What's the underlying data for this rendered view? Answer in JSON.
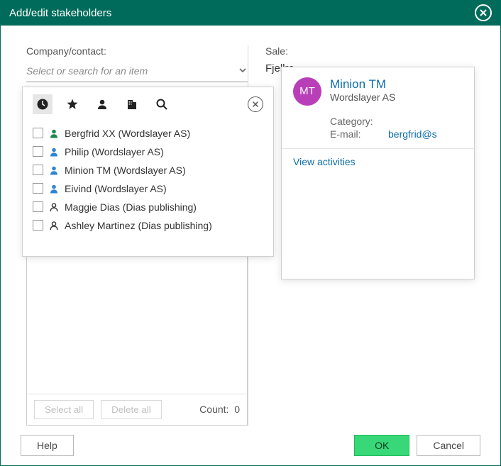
{
  "title": "Add/edit stakeholders",
  "left": {
    "label": "Company/contact:",
    "placeholder": "Select or search for an item"
  },
  "right": {
    "label": "Sale:",
    "value": "Fjellro"
  },
  "dropdown": {
    "items": [
      {
        "name": "Bergfrid XX",
        "company": "(Wordslayer AS)",
        "iconColor": "#1c8b4a",
        "iconType": "solid"
      },
      {
        "name": "Philip",
        "company": "(Wordslayer AS)",
        "iconColor": "#2f86d4",
        "iconType": "solid"
      },
      {
        "name": "Minion TM",
        "company": "(Wordslayer AS)",
        "iconColor": "#2f86d4",
        "iconType": "solid"
      },
      {
        "name": "Eivind",
        "company": "(Wordslayer AS)",
        "iconColor": "#2f86d4",
        "iconType": "solid"
      },
      {
        "name": "Maggie Dias",
        "company": "(Dias publishing)",
        "iconColor": "#333333",
        "iconType": "outline"
      },
      {
        "name": "Ashley Martinez",
        "company": "(Dias publishing)",
        "iconColor": "#333333",
        "iconType": "outline"
      }
    ]
  },
  "card": {
    "initials": "MT",
    "name": "Minion TM",
    "company": "Wordslayer AS",
    "categoryLabel": "Category:",
    "emailLabel": "E-mail:",
    "email": "bergfrid@s",
    "viewActivities": "View activities"
  },
  "selected": {
    "selectAll": "Select all",
    "deleteAll": "Delete all",
    "countLabel": "Count:",
    "countValue": "0"
  },
  "footer": {
    "help": "Help",
    "ok": "OK",
    "cancel": "Cancel"
  }
}
